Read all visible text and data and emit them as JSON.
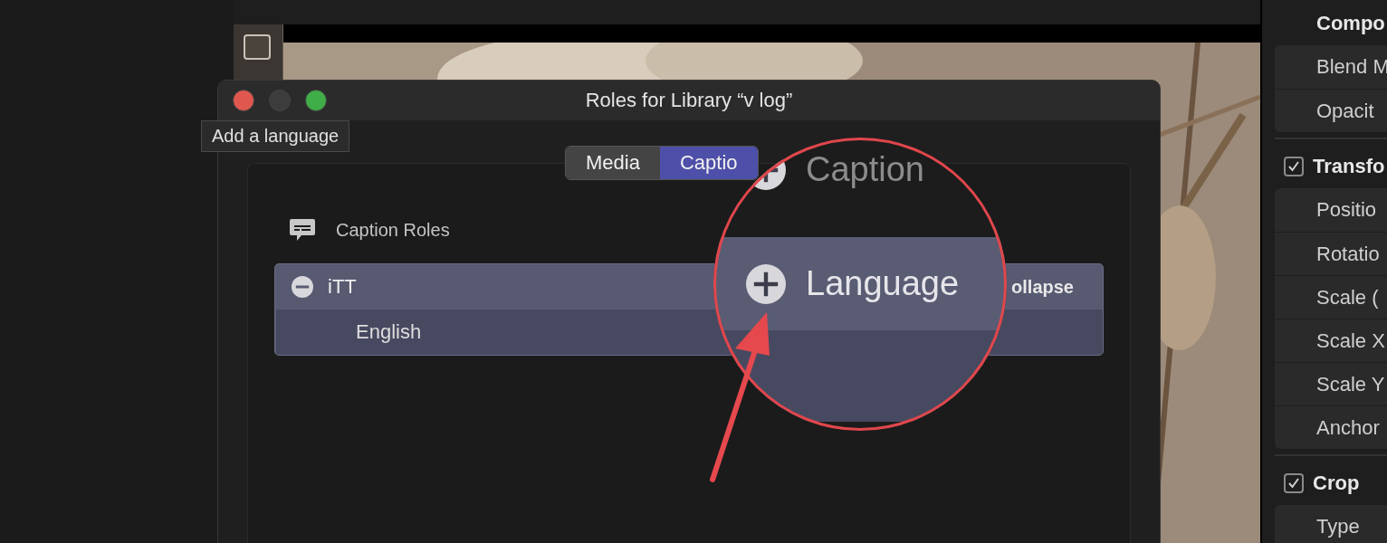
{
  "dialog": {
    "title": "Roles for Library “v log”",
    "tooltip": "Add a language",
    "tabs": [
      {
        "label": "Media",
        "selected": false
      },
      {
        "label": "Captio",
        "selected": true
      }
    ],
    "section_title": "Caption Roles",
    "roles": [
      {
        "name": "iTT",
        "expanded": true,
        "action": "ollapse",
        "children": [
          {
            "name": "English"
          }
        ]
      }
    ]
  },
  "magnifier": {
    "heading": "Caption",
    "button": "Language"
  },
  "inspector": {
    "sections": [
      {
        "kind": "plain",
        "title": "Compo",
        "rows": [
          "Blend M",
          "Opacit"
        ]
      },
      {
        "kind": "toggle",
        "checked": true,
        "title": "Transfo",
        "rows": [
          "Positio",
          "Rotatio",
          "Scale (",
          "Scale X",
          "Scale Y",
          "Anchor"
        ]
      },
      {
        "kind": "toggle",
        "checked": true,
        "title": "Crop",
        "rows": [
          "Type"
        ]
      }
    ]
  }
}
